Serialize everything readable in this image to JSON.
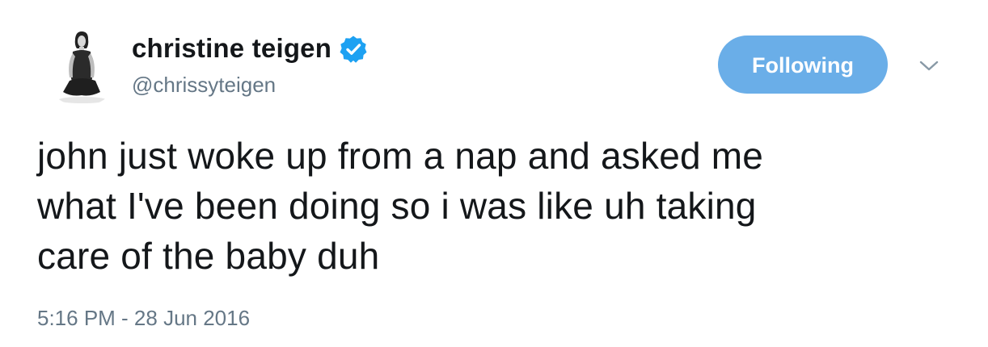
{
  "user": {
    "display_name": "christine teigen",
    "handle": "@chrissyteigen",
    "verified": true,
    "avatar_icon": "profile-photo"
  },
  "follow_button": {
    "label": "Following"
  },
  "menu": {
    "icon": "chevron-down-icon"
  },
  "tweet": {
    "lines": [
      "john just woke up from a nap and asked me",
      "what I've been doing so i was like uh taking",
      "care of the baby duh"
    ],
    "timestamp": "5:16 PM - 28 Jun 2016"
  },
  "colors": {
    "accent": "#6aaee8",
    "verified_badge": "#1da1f2",
    "secondary_text": "#657786",
    "primary_text": "#14171a"
  }
}
